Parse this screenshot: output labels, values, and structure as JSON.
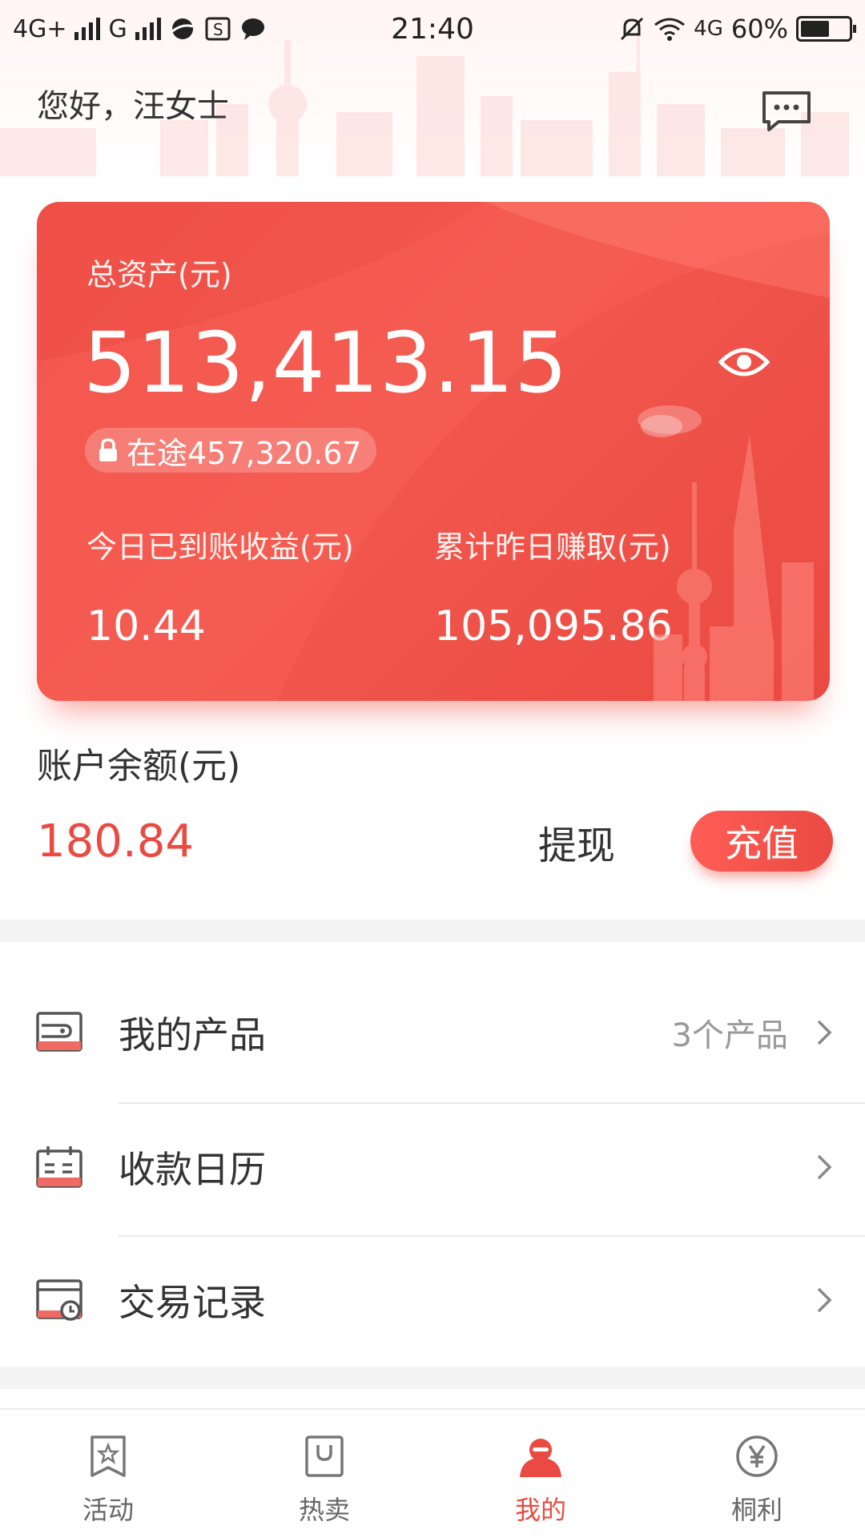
{
  "status_bar": {
    "left_network_1": "4G+",
    "left_network_2": "G",
    "time": "21:40",
    "right_network": "4G",
    "battery": "60%",
    "battery_level": 0.6
  },
  "header": {
    "greeting": "您好，汪女士",
    "message_icon": "chat-bubble-icon"
  },
  "asset_card": {
    "total_label": "总资产(元)",
    "total_value": "513,413.15",
    "in_transit": "在途457,320.67",
    "today_income_label": "今日已到账收益(元)",
    "today_income_value": "10.44",
    "cumulative_label": "累计昨日赚取(元)",
    "cumulative_value": "105,095.86",
    "accent_color": "#ea4a42"
  },
  "balance": {
    "label": "账户余额(元)",
    "value": "180.84",
    "withdraw_label": "提现",
    "recharge_label": "充值"
  },
  "menu": [
    {
      "label": "我的产品",
      "sub": "3个产品",
      "icon": "wallet-icon"
    },
    {
      "label": "收款日历",
      "sub": "",
      "icon": "calendar-icon"
    },
    {
      "label": "交易记录",
      "sub": "",
      "icon": "record-clock-icon"
    }
  ],
  "bottom_nav": [
    {
      "label": "活动",
      "icon": "star-bookmark-icon",
      "active": false
    },
    {
      "label": "热卖",
      "icon": "shopping-bag-icon",
      "active": false
    },
    {
      "label": "我的",
      "icon": "person-icon",
      "active": true
    },
    {
      "label": "桐利",
      "icon": "yen-coin-icon",
      "active": false
    }
  ]
}
